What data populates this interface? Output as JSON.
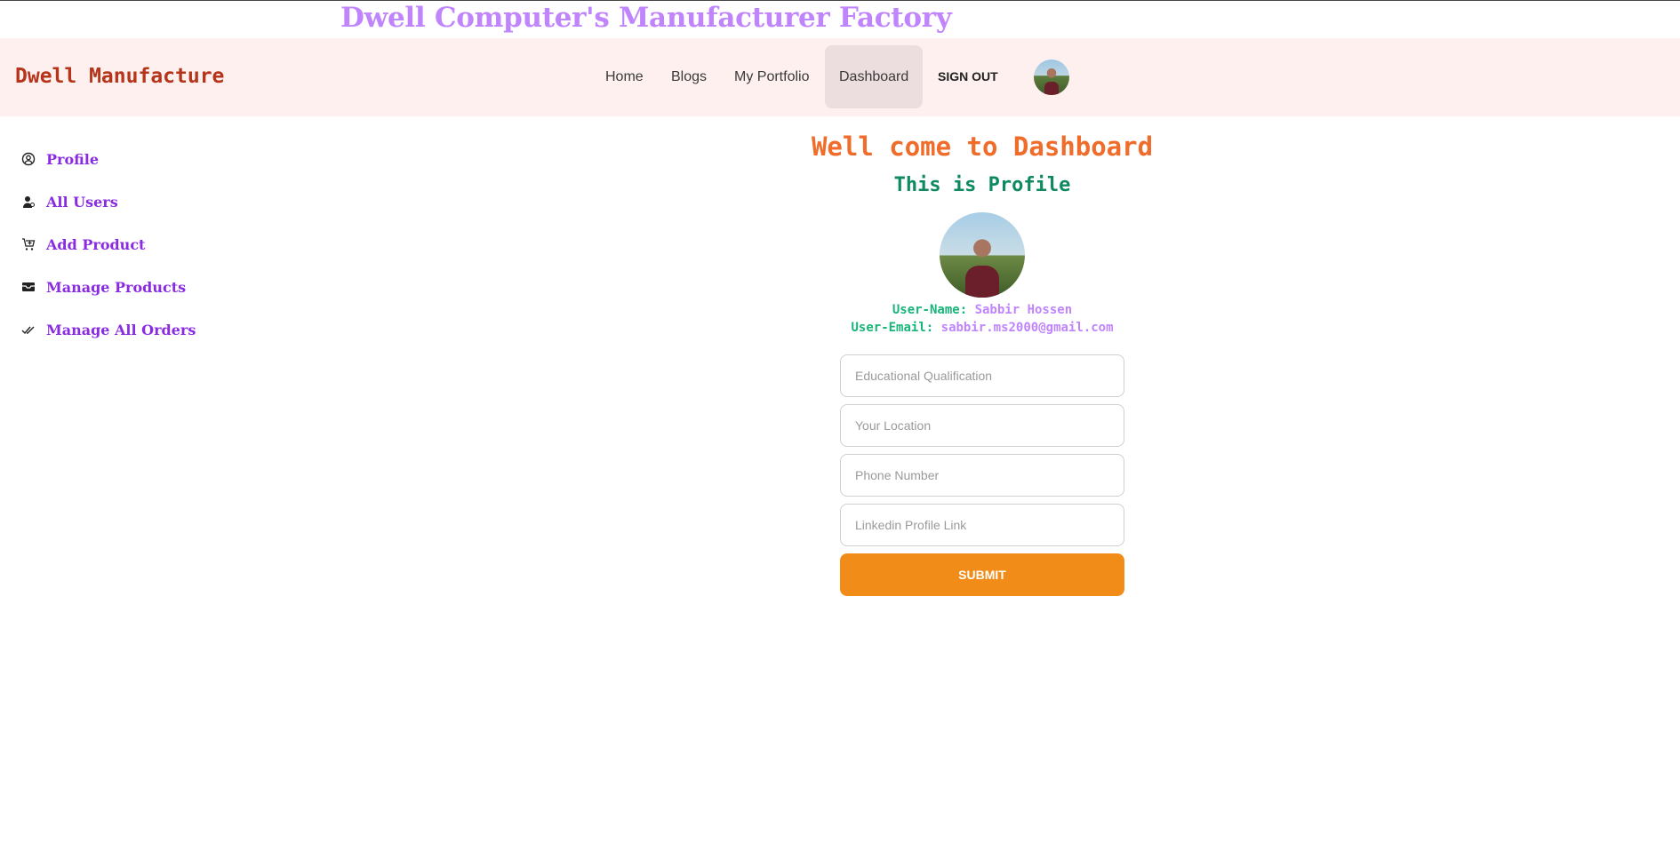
{
  "site_title": "Dwell Computer's Manufacturer Factory",
  "navbar": {
    "brand": "Dwell Manufacture",
    "links": [
      {
        "label": "Home"
      },
      {
        "label": "Blogs"
      },
      {
        "label": "My Portfolio"
      },
      {
        "label": "Dashboard",
        "active": true
      }
    ],
    "signout_label": "SIGN OUT",
    "avatar_icon": "user-avatar"
  },
  "sidebar": {
    "items": [
      {
        "label": "Profile",
        "icon": "user-circle-icon"
      },
      {
        "label": "All Users",
        "icon": "user-icon"
      },
      {
        "label": "Add Product",
        "icon": "cart-plus-icon"
      },
      {
        "label": "Manage Products",
        "icon": "tray-icon"
      },
      {
        "label": "Manage All Orders",
        "icon": "double-check-icon"
      }
    ]
  },
  "main": {
    "welcome": "Well come to Dashboard",
    "heading": "This is Profile",
    "user_name_key": "User-Name:",
    "user_name": "Sabbir Hossen",
    "user_email_key": "User-Email:",
    "user_email": "sabbir.ms2000@gmail.com"
  },
  "form": {
    "education_placeholder": "Educational Qualification",
    "location_placeholder": "Your Location",
    "phone_placeholder": "Phone Number",
    "linkedin_placeholder": "Linkedin Profile Link",
    "submit_label": "SUBMIT"
  },
  "colors": {
    "site_title": "#c084fc",
    "brand": "#b5341a",
    "navbar_bg": "#fff0f0",
    "sidebar_link": "#8a2be2",
    "welcome": "#ef6c2b",
    "profile_heading": "#0f8a5f",
    "submit_bg": "#f28c18"
  }
}
